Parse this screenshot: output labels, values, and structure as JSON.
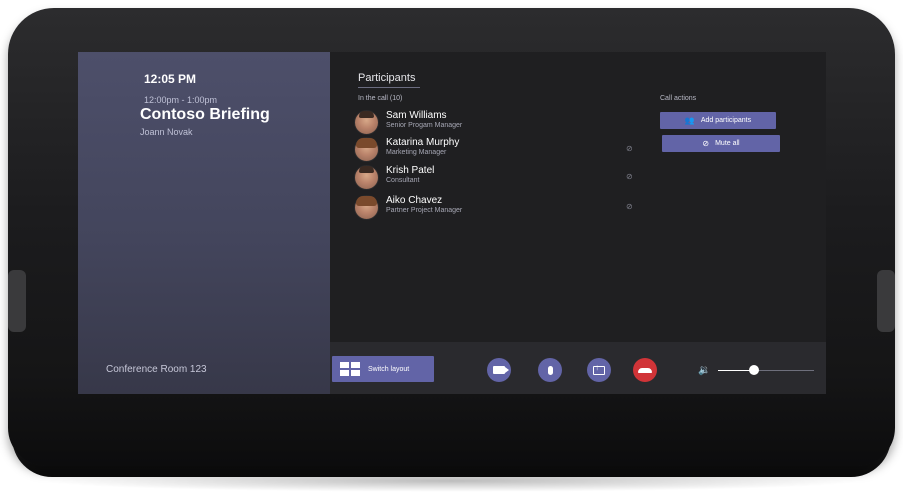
{
  "clock": "12:05 PM",
  "meeting": {
    "time_range": "12:00pm - 1:00pm",
    "title": "Contoso Briefing",
    "organizer": "Joann Novak"
  },
  "room_name": "Conference Room 123",
  "participants_panel": {
    "title": "Participants",
    "in_call_label": "In the call (10)",
    "participants": [
      {
        "name": "Sam Williams",
        "role": "Senior Progam Manager",
        "muted": false
      },
      {
        "name": "Katarina Murphy",
        "role": "Marketing Manager",
        "muted": true
      },
      {
        "name": "Krish Patel",
        "role": "Consultant",
        "muted": true
      },
      {
        "name": "Aiko Chavez",
        "role": "Partner Project Manager",
        "muted": true
      }
    ]
  },
  "call_actions": {
    "label": "Call actions",
    "add_participants": "Add participants",
    "mute_all": "Mute all"
  },
  "control_bar": {
    "switch_layout": "Switch layout",
    "buttons": [
      "camera-icon",
      "microphone-icon",
      "share-screen-icon",
      "hang-up-icon"
    ],
    "volume_level": 0.38
  },
  "colors": {
    "accent": "#6264a7",
    "hang_up": "#d13438",
    "left_panel": "#4d4f6a",
    "screen_bg": "#1f1f21"
  }
}
